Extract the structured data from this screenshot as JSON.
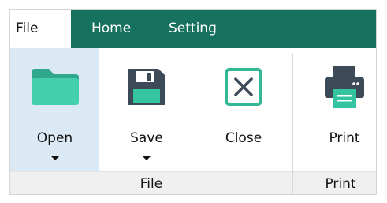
{
  "tabs": [
    {
      "label": "File",
      "active": true
    },
    {
      "label": "Home",
      "active": false
    },
    {
      "label": "Setting",
      "active": false
    }
  ],
  "groups": [
    {
      "name": "File",
      "buttons": [
        {
          "label": "Open",
          "icon": "folder-icon",
          "dropdown": true
        },
        {
          "label": "Save",
          "icon": "floppy-disk-icon",
          "dropdown": true
        },
        {
          "label": "Close",
          "icon": "close-box-icon",
          "dropdown": false
        }
      ]
    },
    {
      "name": "Print",
      "buttons": [
        {
          "label": "Print",
          "icon": "printer-icon",
          "dropdown": false
        }
      ]
    }
  ],
  "colors": {
    "tabbar": "#17715f",
    "icon_teal": "#33c5a3",
    "icon_dark": "#3d4a57",
    "hover": "#dbe9f5",
    "footer": "#f0f0f0"
  }
}
